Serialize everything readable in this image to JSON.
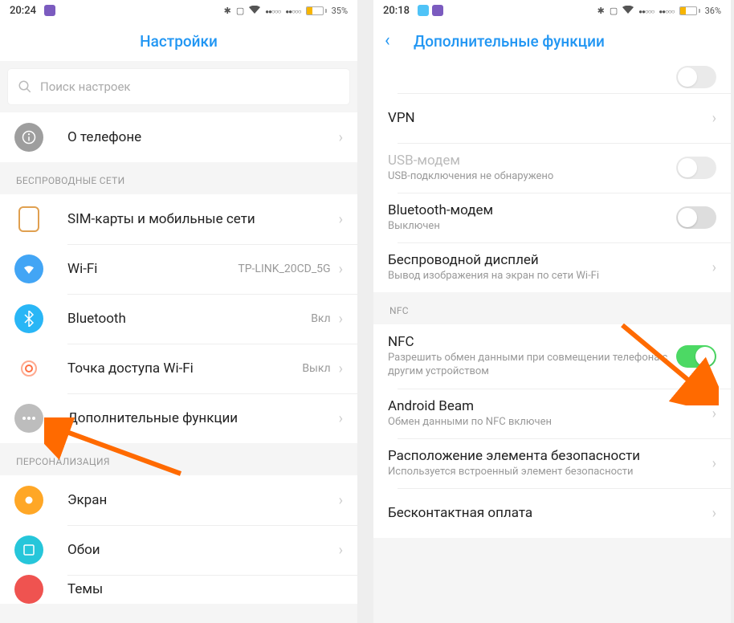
{
  "left": {
    "status": {
      "time": "20:24",
      "battery": "35%"
    },
    "title": "Настройки",
    "searchPlaceholder": "Поиск настроек",
    "aboutPhone": "О телефоне",
    "section_wireless": "БЕСПРОВОДНЫЕ СЕТИ",
    "sim": "SIM-карты и мобильные сети",
    "wifi": {
      "label": "Wi-Fi",
      "value": "TP-LINK_20CD_5G"
    },
    "bt": {
      "label": "Bluetooth",
      "value": "Вкл"
    },
    "hotspot": {
      "label": "Точка доступа Wi-Fi",
      "value": "Выкл"
    },
    "more": "Дополнительные функции",
    "section_personal": "ПЕРСОНАЛИЗАЦИЯ",
    "display": "Экран",
    "wallpaper": "Обои",
    "themes": "Темы"
  },
  "right": {
    "status": {
      "time": "20:18",
      "battery": "36%"
    },
    "title": "Дополнительные функции",
    "vpn": "VPN",
    "usb": {
      "label": "USB-модем",
      "sub": "USB-подключения не обнаружено"
    },
    "btm": {
      "label": "Bluetooth-модем",
      "sub": "Выключен"
    },
    "cast": {
      "label": "Беспроводной дисплей",
      "sub": "Вывод изображения на экран по сети Wi-Fi"
    },
    "nfc_section": "NFC",
    "nfc": {
      "label": "NFC",
      "sub": "Разрешить обмен данными при совмещении телефона с другим устройством"
    },
    "beam": {
      "label": "Android Beam",
      "sub": "Обмен данными по NFC включен"
    },
    "secelem": {
      "label": "Расположение элемента безопасности",
      "sub": "Используется встроенный элемент безопасности"
    },
    "tap": "Бесконтактная оплата"
  }
}
